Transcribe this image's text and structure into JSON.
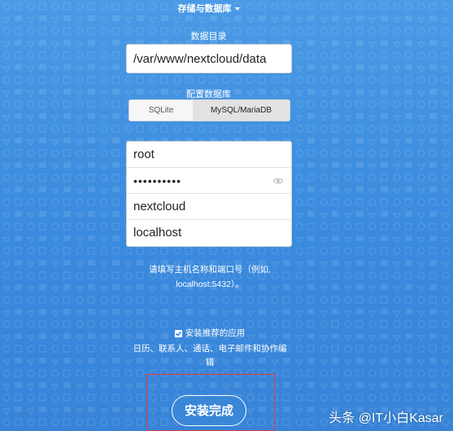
{
  "storage_toggle": {
    "label": "存储与数据库"
  },
  "data_folder": {
    "label": "数据目录",
    "value": "/var/www/nextcloud/data"
  },
  "database": {
    "label": "配置数据库",
    "options": [
      {
        "label": "SQLite",
        "selected": false
      },
      {
        "label": "MySQL/MariaDB",
        "selected": true
      }
    ]
  },
  "credentials": {
    "user": "root",
    "password_mask": "••••••••••",
    "db_name": "nextcloud",
    "db_host": "localhost"
  },
  "hint": {
    "line1": "请填写主机名称和端口号（例如,",
    "line2": "localhost:5432）。"
  },
  "recommended_apps": {
    "checked": true,
    "label": "安装推荐的应用",
    "description": "日历、联系人、通话、电子邮件和协作编辑"
  },
  "finish_button": {
    "label": "安装完成"
  },
  "watermark": {
    "text": "头条 @IT小白Kasar"
  },
  "colors": {
    "background": "#3d8fe0",
    "highlight_border": "#e23b3b"
  }
}
